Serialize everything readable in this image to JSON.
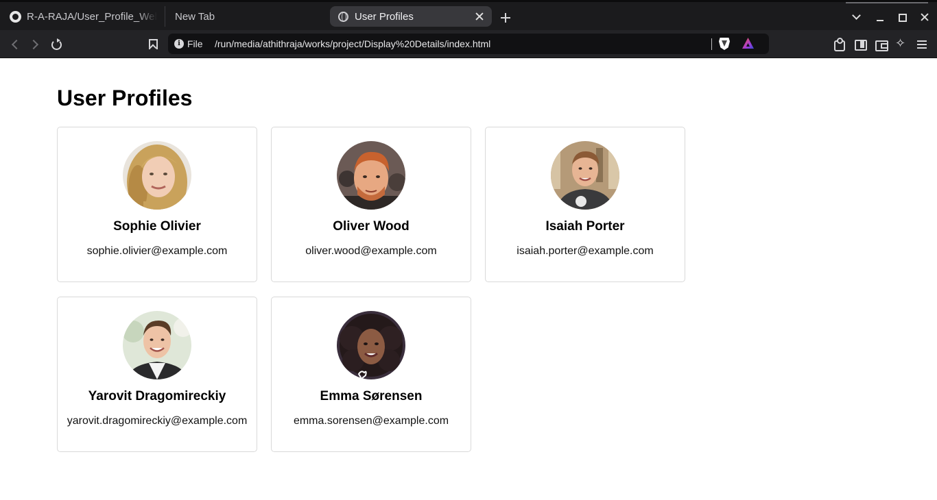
{
  "browser": {
    "tabs": [
      {
        "label": "R-A-RAJA/User_Profile_Web",
        "icon": "github-icon",
        "active": false
      },
      {
        "label": "New Tab",
        "icon": "",
        "active": false
      },
      {
        "label": "User Profiles",
        "icon": "globe-icon",
        "active": true
      }
    ],
    "address_bar": {
      "scheme_label": "File",
      "url": "/run/media/athithraja/works/project/Display%20Details/index.html"
    }
  },
  "page": {
    "title": "User Profiles",
    "users": [
      {
        "name": "Sophie Olivier",
        "email": "sophie.olivier@example.com",
        "avatar": "woman-blonde-photo"
      },
      {
        "name": "Oliver Wood",
        "email": "oliver.wood@example.com",
        "avatar": "man-red-hair-photo"
      },
      {
        "name": "Isaiah Porter",
        "email": "isaiah.porter@example.com",
        "avatar": "man-dark-shirt-photo"
      },
      {
        "name": "Yarovit Dragomireckiy",
        "email": "yarovit.dragomireckiy@example.com",
        "avatar": "man-blazer-photo"
      },
      {
        "name": "Emma Sørensen",
        "email": "emma.sorensen@example.com",
        "avatar": "woman-curly-hair-photo"
      }
    ]
  },
  "colors": {
    "chrome_bg": "#1b1b1d",
    "toolbar_bg": "#232326",
    "active_tab": "#38383c",
    "urlbar_bg": "#111113",
    "card_border": "#d9d9d9"
  }
}
